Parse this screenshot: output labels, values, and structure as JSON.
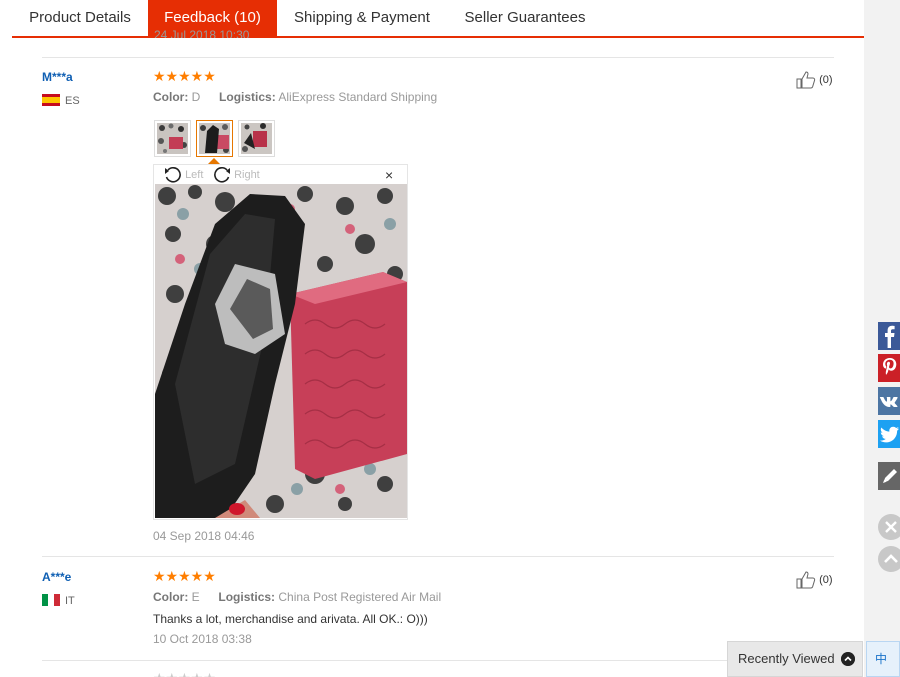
{
  "tabs": {
    "product_details": "Product Details",
    "feedback": "Feedback (10)",
    "shipping": "Shipping & Payment",
    "seller": "Seller Guarantees"
  },
  "top_cut_text": "24 Jul 2018 10:30",
  "reviews": [
    {
      "user": "M***a",
      "country": "ES",
      "stars": "★★★★★",
      "color_label": "Color:",
      "color_value": "D",
      "logistics_label": "Logistics:",
      "logistics_value": "AliExpress Standard Shipping",
      "useful": "(0)",
      "date": "04 Sep 2018 04:46"
    },
    {
      "user": "A***e",
      "country": "IT",
      "stars": "★★★★★",
      "color_label": "Color:",
      "color_value": "E",
      "logistics_label": "Logistics:",
      "logistics_value": "China Post Registered Air Mail",
      "useful": "(0)",
      "text": "Thanks a lot, merchandise and arivata. All OK.: O)))",
      "date": "10 Oct 2018 03:38"
    }
  ],
  "viewer": {
    "rotate_left": "Left",
    "rotate_right": "Right",
    "close": "×"
  },
  "recently_viewed": "Recently Viewed",
  "ime_label": "中",
  "colors": {
    "accent": "#e62e04",
    "star": "#ff7e00",
    "username": "#0f5fb3",
    "facebook": "#3b5998",
    "pinterest": "#cb2027",
    "vk": "#4c75a3",
    "twitter": "#1da1f2",
    "edit": "#666666"
  },
  "icons": [
    "thumbs-up-icon",
    "rotate-left-icon",
    "rotate-right-icon",
    "close-icon",
    "facebook-icon",
    "pinterest-icon",
    "vk-icon",
    "twitter-icon",
    "edit-icon",
    "chevron-up-icon"
  ]
}
